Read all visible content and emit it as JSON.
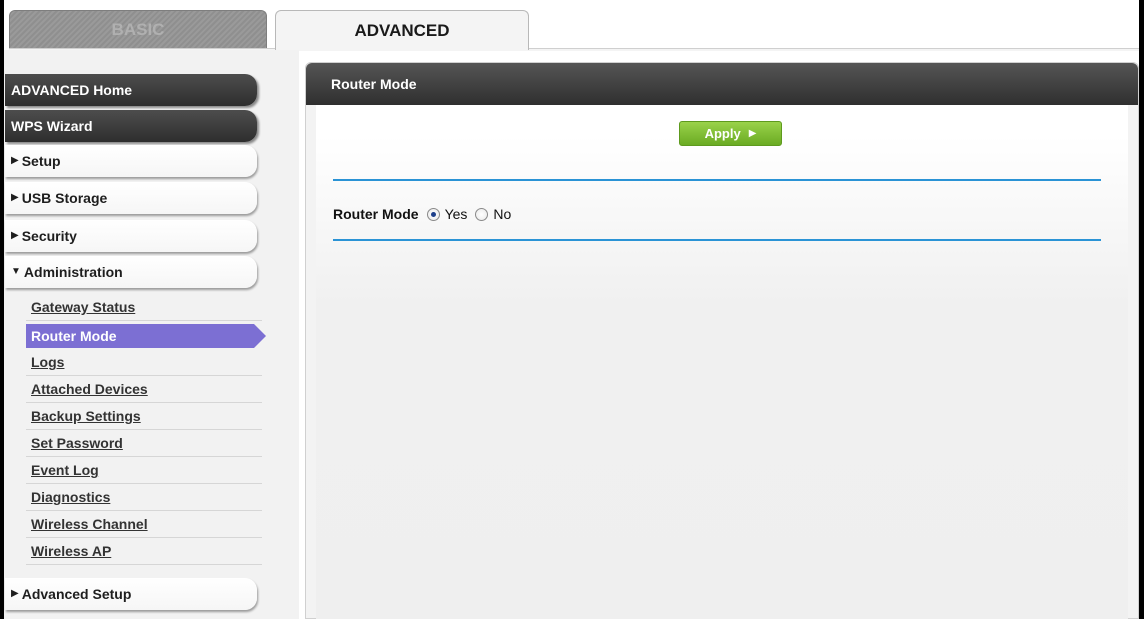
{
  "tabs": {
    "basic_label": "BASIC",
    "advanced_label": "ADVANCED"
  },
  "sidebar": {
    "advanced_home": "ADVANCED Home",
    "wps_wizard": "WPS Wizard",
    "setup": "Setup",
    "usb_storage": "USB Storage",
    "security": "Security",
    "administration": "Administration",
    "administration_items": [
      "Gateway Status",
      "Router Mode",
      "Logs",
      "Attached Devices",
      "Backup Settings",
      "Set Password",
      "Event Log",
      "Diagnostics",
      "Wireless Channel",
      "Wireless AP"
    ],
    "active_item": "Router Mode",
    "advanced_setup": "Advanced Setup"
  },
  "main": {
    "panel_title": "Router Mode",
    "apply_label": "Apply",
    "router_mode_label": "Router Mode",
    "option_yes": "Yes",
    "option_no": "No",
    "selected_option": "Yes"
  },
  "colors": {
    "active_nav": "#7c6fd3",
    "apply_green": "#7bbd35",
    "divider_blue": "#2a93d5",
    "header_dark": "#3a3a3a"
  }
}
